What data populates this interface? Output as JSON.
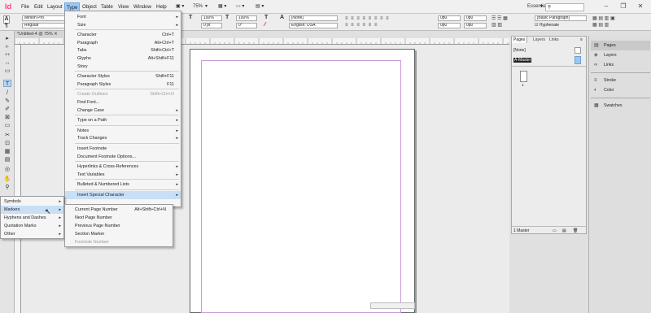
{
  "app": {
    "logo": "Id",
    "menus": [
      "File",
      "Edit",
      "Layout",
      "Type",
      "Object",
      "Table",
      "View",
      "Window",
      "Help"
    ],
    "active_menu": "Type",
    "zoom": "75%",
    "workspace": "Essentials",
    "search_placeholder": "",
    "window_buttons": [
      "–",
      "❐",
      "✕"
    ]
  },
  "control_panel": {
    "font": "Minion Pro",
    "style": "Regular",
    "size": "12 pt",
    "leading": "(14.4 pt)",
    "scale_h": "100%",
    "scale_v": "100%",
    "tracking": "0",
    "kerning": "0 pt",
    "angle": "0°",
    "char_style": "[None]",
    "language": "English: USA",
    "indents": [
      "0p0",
      "0p0",
      "0p0",
      "0p0"
    ],
    "para_style": "[Basic Paragraph]",
    "hyphenate_label": "Hyphenate",
    "hyphenate_checked": true,
    "letter_A": "A",
    "letter_T": "T"
  },
  "document": {
    "tab_title": "*Untitled-4 @ 75%"
  },
  "tools": [
    "▸",
    "▹",
    "⇿",
    "↔",
    "▭",
    "T",
    "/",
    "✎",
    "✐",
    "⊠",
    "▭",
    "✂",
    "⊡",
    "▦",
    "▤",
    "◎",
    "✋",
    "⚲"
  ],
  "type_menu": {
    "items": [
      {
        "label": "Font",
        "shortcut": "",
        "submenu": true,
        "disabled": false
      },
      {
        "label": "Size",
        "shortcut": "",
        "submenu": true,
        "disabled": false
      },
      {
        "sep": true
      },
      {
        "label": "Character",
        "shortcut": "Ctrl+T",
        "submenu": false,
        "disabled": false
      },
      {
        "label": "Paragraph",
        "shortcut": "Alt+Ctrl+T",
        "submenu": false,
        "disabled": false
      },
      {
        "label": "Tabs",
        "shortcut": "Shift+Ctrl+T",
        "submenu": false,
        "disabled": false
      },
      {
        "label": "Glyphs",
        "shortcut": "Alt+Shift+F11",
        "submenu": false,
        "disabled": false
      },
      {
        "label": "Story",
        "shortcut": "",
        "submenu": false,
        "disabled": false
      },
      {
        "sep": true
      },
      {
        "label": "Character Styles",
        "shortcut": "Shift+F11",
        "submenu": false,
        "disabled": false
      },
      {
        "label": "Paragraph Styles",
        "shortcut": "F11",
        "submenu": false,
        "disabled": false
      },
      {
        "sep": true
      },
      {
        "label": "Create Outlines",
        "shortcut": "Shift+Ctrl+O",
        "submenu": false,
        "disabled": true
      },
      {
        "label": "Find Font...",
        "shortcut": "",
        "submenu": false,
        "disabled": false
      },
      {
        "label": "Change Case",
        "shortcut": "",
        "submenu": true,
        "disabled": false
      },
      {
        "sep": true
      },
      {
        "label": "Type on a Path",
        "shortcut": "",
        "submenu": true,
        "disabled": false
      },
      {
        "sep": true
      },
      {
        "label": "Notes",
        "shortcut": "",
        "submenu": true,
        "disabled": false
      },
      {
        "label": "Track Changes",
        "shortcut": "",
        "submenu": true,
        "disabled": false
      },
      {
        "sep": true
      },
      {
        "label": "Insert Footnote",
        "shortcut": "",
        "submenu": false,
        "disabled": false
      },
      {
        "label": "Document Footnote Options...",
        "shortcut": "",
        "submenu": false,
        "disabled": false
      },
      {
        "sep": true
      },
      {
        "label": "Hyperlinks & Cross-References",
        "shortcut": "",
        "submenu": true,
        "disabled": false
      },
      {
        "label": "Text Variables",
        "shortcut": "",
        "submenu": true,
        "disabled": false
      },
      {
        "sep": true
      },
      {
        "label": "Bulleted & Numbered Lists",
        "shortcut": "",
        "submenu": true,
        "disabled": false
      },
      {
        "sep": true
      },
      {
        "label": "Insert Special Character",
        "shortcut": "",
        "submenu": true,
        "disabled": false,
        "highlight": true
      }
    ]
  },
  "special_char_menu": {
    "items": [
      {
        "label": "Symbols",
        "submenu": true
      },
      {
        "label": "Markers",
        "submenu": true,
        "highlight": true
      },
      {
        "label": "Hyphens and Dashes",
        "submenu": true
      },
      {
        "label": "Quotation Marks",
        "submenu": true
      },
      {
        "label": "Other",
        "submenu": true
      }
    ]
  },
  "markers_menu": {
    "items": [
      {
        "label": "Current Page Number",
        "shortcut": "Alt+Shift+Ctrl+N",
        "disabled": false
      },
      {
        "label": "Next Page Number",
        "shortcut": "",
        "disabled": false
      },
      {
        "label": "Previous Page Number",
        "shortcut": "",
        "disabled": false
      },
      {
        "label": "Section Marker",
        "shortcut": "",
        "disabled": false
      },
      {
        "label": "Footnote Number",
        "shortcut": "",
        "disabled": true
      }
    ]
  },
  "pages_panel": {
    "tabs": [
      "Pages",
      "Layers",
      "Links"
    ],
    "none_label": "[None]",
    "master_label": "A-Master",
    "page_number": "1",
    "status": "1 Master"
  },
  "dock": {
    "items": [
      {
        "label": "Pages",
        "icon": "pages-icon",
        "glyph": "▤"
      },
      {
        "label": "Layers",
        "icon": "layers-icon",
        "glyph": "◈"
      },
      {
        "label": "Links",
        "icon": "links-icon",
        "glyph": "∞"
      },
      {
        "label": "Stroke",
        "icon": "stroke-icon",
        "glyph": "≡"
      },
      {
        "label": "Color",
        "icon": "color-icon",
        "glyph": "◐"
      },
      {
        "label": "Swatches",
        "icon": "swatches-icon",
        "glyph": "▦"
      }
    ]
  },
  "colors": {
    "accent": "#ff3d7a",
    "highlight": "#c9dff5",
    "margin_guide": "#c89ad6"
  }
}
